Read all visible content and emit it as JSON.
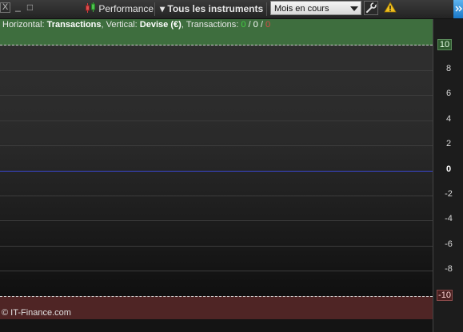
{
  "toolbar": {
    "close_symbol": "X",
    "minimize_symbol": "_",
    "maximize_symbol": "□",
    "performance_label": "Performance",
    "instruments_label": "Tous les instruments",
    "instruments_arrow": "▾",
    "period_value": "Mois en cours",
    "settings_icon": "wrench-icon",
    "warning_icon": "warning-icon",
    "warning_color": "#f0c020"
  },
  "chart": {
    "info": {
      "horizontal_prefix": "Horizontal: ",
      "horizontal_value": "Transactions",
      "vertical_prefix": ", Vertical: ",
      "vertical_value": "Devise (€)",
      "transactions_prefix": ", Transactions: ",
      "win_count": "0",
      "slash1": " / ",
      "neutral_count": "0",
      "slash2": " / ",
      "loss_count": "0"
    },
    "copyright": "© IT-Finance.com",
    "colors": {
      "profit_band": "#3e6e3e",
      "loss_band": "#4f2525",
      "zero_line": "#3a46d0"
    }
  },
  "chart_data": {
    "type": "line",
    "ylim": [
      -10,
      10
    ],
    "y_ticks": [
      "10",
      "8",
      "6",
      "4",
      "2",
      "0",
      "-2",
      "-4",
      "-6",
      "-8",
      "-10"
    ],
    "series": []
  }
}
